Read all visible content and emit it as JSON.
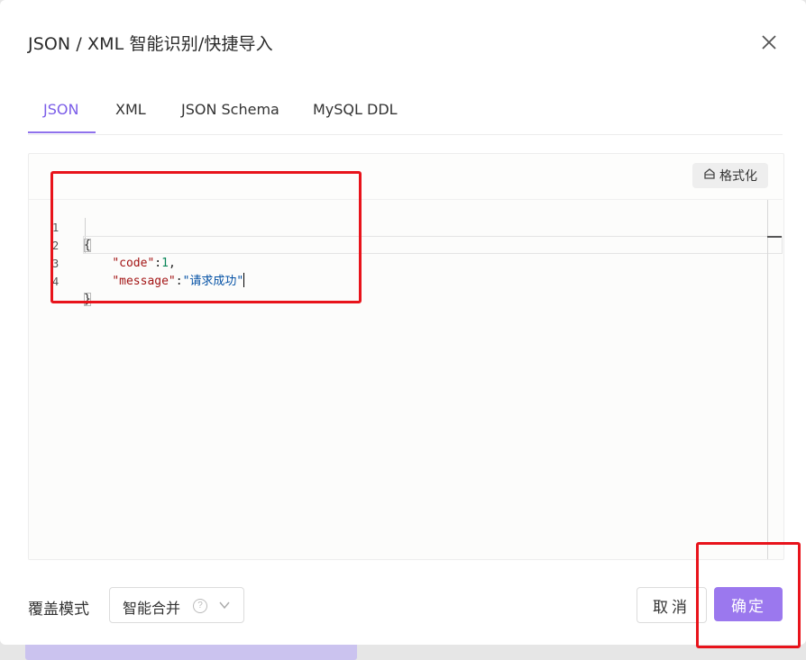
{
  "dialog": {
    "title": "JSON / XML 智能识别/快捷导入"
  },
  "tabs": [
    {
      "label": "JSON",
      "active": true
    },
    {
      "label": "XML",
      "active": false
    },
    {
      "label": "JSON Schema",
      "active": false
    },
    {
      "label": "MySQL DDL",
      "active": false
    }
  ],
  "editor": {
    "format_label": "格式化",
    "lines": [
      {
        "num": "1",
        "text": "{"
      },
      {
        "num": "2",
        "key": "\"code\"",
        "sep": ":",
        "value": "1",
        "trail": ","
      },
      {
        "num": "3",
        "key": "\"message\"",
        "sep": ":",
        "value": "\"请求成功\""
      },
      {
        "num": "4",
        "text": "}"
      }
    ]
  },
  "footer": {
    "mode_label": "覆盖模式",
    "mode_value": "智能合并",
    "help_glyph": "?",
    "cancel_label": "取消",
    "ok_label": "确定"
  },
  "colors": {
    "accent": "#7b5de8",
    "primary_button": "#9b78ee",
    "annotation": "#e8131b"
  }
}
